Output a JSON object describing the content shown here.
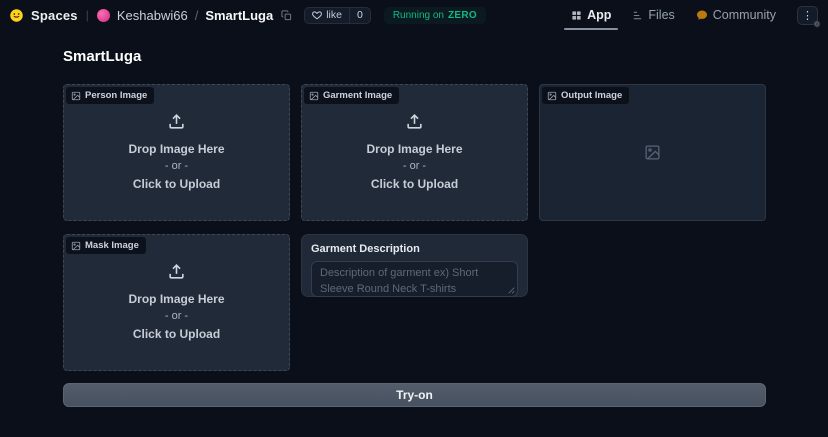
{
  "navbar": {
    "brand": "Spaces",
    "divider": "|",
    "owner": "Keshabwi66",
    "separator": "/",
    "space_name": "SmartLuga",
    "like": {
      "label": "like",
      "count": "0"
    },
    "status": {
      "prefix": "Running on",
      "hardware": "ZERO"
    },
    "tabs": {
      "app": "App",
      "files": "Files",
      "community": "Community"
    },
    "menu": "⋮"
  },
  "page": {
    "title": "SmartLuga"
  },
  "upload_boxes": [
    {
      "label": "Person Image",
      "drop": "Drop Image Here",
      "or": "- or -",
      "click": "Click to Upload"
    },
    {
      "label": "Garment Image",
      "drop": "Drop Image Here",
      "or": "- or -",
      "click": "Click to Upload"
    },
    {
      "label": "Mask Image",
      "drop": "Drop Image Here",
      "or": "- or -",
      "click": "Click to Upload"
    }
  ],
  "output_box": {
    "label": "Output Image"
  },
  "garment_description": {
    "label": "Garment Description",
    "placeholder": "Description of garment ex) Short Sleeve Round Neck T-shirts",
    "value": ""
  },
  "actions": {
    "try_on": "Try-on"
  },
  "icons": {
    "logo": "huggingface-smiley",
    "like": "heart-outline",
    "copy": "copy-duplicate",
    "app_tab": "grid",
    "files_tab": "file-list",
    "community_tab": "chat-bubble",
    "menu": "vertical-ellipsis",
    "settings": "gear",
    "upload": "upload-tray-arrow",
    "image": "image-placeholder"
  },
  "colors": {
    "background": "#0b0f19",
    "panel": "#212a39",
    "accent_green": "#10b981",
    "avatar_pink": "#db2777",
    "hf_yellow": "#ffd21e",
    "community_yellow": "#f59e0b"
  }
}
